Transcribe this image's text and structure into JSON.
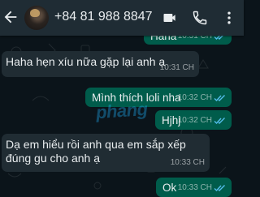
{
  "header": {
    "contact_name": "+84 81 988 8847",
    "icons": [
      "back-arrow-icon",
      "video-call-icon",
      "phone-call-icon",
      "more-options-icon"
    ]
  },
  "watermark": "phang",
  "messages": [
    {
      "direction": "out",
      "text": "Haha",
      "time": "10:31 CH",
      "status": "read"
    },
    {
      "direction": "in",
      "text": "Haha hẹn xíu nữa gặp lại anh ạ",
      "time": "10:31 CH"
    },
    {
      "direction": "out",
      "text": "Mình thích loli nha",
      "time": "10:32 CH",
      "status": "read"
    },
    {
      "direction": "out",
      "text": "Hjhj",
      "time": "10:32 CH",
      "status": "read"
    },
    {
      "direction": "in",
      "text": "Dạ em hiểu rồi anh qua em sắp xếp đúng gu cho anh ạ",
      "time": "10:33 CH"
    },
    {
      "direction": "out",
      "text": "Ok",
      "time": "10:33 CH",
      "status": "read"
    }
  ],
  "colors": {
    "header_bg": "#1f2c34",
    "chat_bg": "#0b141a",
    "incoming_bubble": "#202c33",
    "outgoing_bubble": "#005c4b",
    "read_tick": "#53bdeb"
  }
}
